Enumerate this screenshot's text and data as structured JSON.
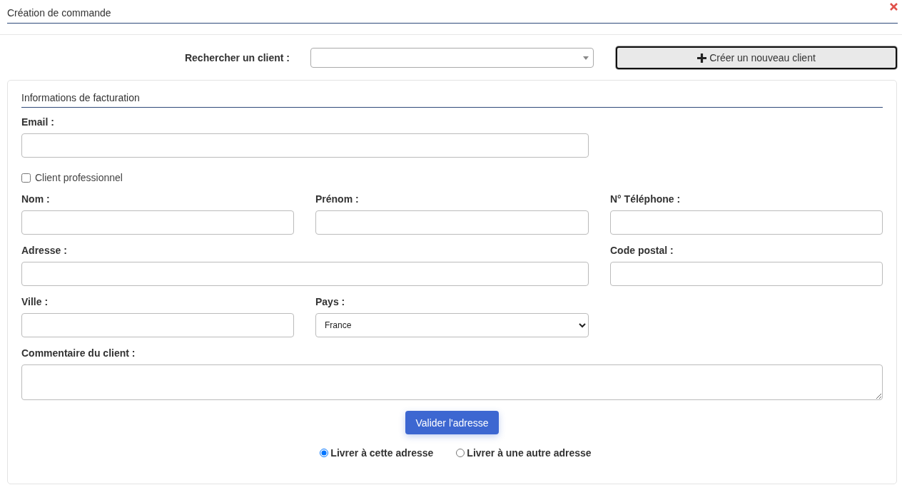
{
  "window": {
    "title": "Création de commande"
  },
  "client_search": {
    "label": "Rechercher un client :"
  },
  "create_client_button": {
    "label": "Créer un nouveau client"
  },
  "billing": {
    "title": "Informations de facturation",
    "email": {
      "label": "Email :"
    },
    "professional": {
      "label": "Client professionnel",
      "checked": false
    },
    "fields": [
      {
        "label": "Nom :",
        "kind": "text"
      },
      {
        "label": "Prénom :",
        "kind": "text"
      },
      {
        "label": "N° Téléphone :",
        "kind": "text"
      },
      {
        "label": "Adresse :",
        "kind": "wide-text"
      },
      {
        "label": "Code postal :",
        "kind": "text"
      },
      {
        "label": "Ville :",
        "kind": "text"
      },
      {
        "label": "Pays :",
        "kind": "select",
        "value": "France"
      }
    ],
    "comment": {
      "label": "Commentaire du client :"
    },
    "validate_button": {
      "label": "Valider l'adresse"
    },
    "delivery_options": [
      {
        "label": "Livrer à cette adresse",
        "selected": true
      },
      {
        "label": "Livrer à une autre adresse",
        "selected": false
      }
    ]
  }
}
